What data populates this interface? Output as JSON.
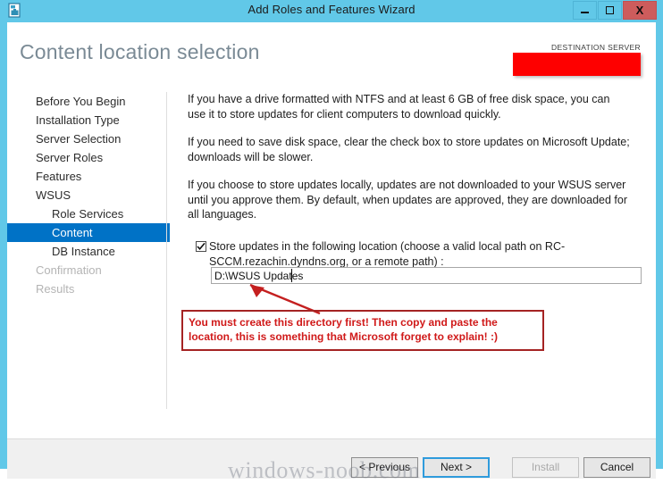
{
  "window": {
    "title": "Add Roles and Features Wizard",
    "app_icon": "server-manager-icon",
    "controls": {
      "minimize": "minimize-icon",
      "maximize": "maximize-icon",
      "close": "X"
    },
    "titlebar_color": "#61c8e8"
  },
  "header": {
    "page_title": "Content location selection",
    "destination_server_label": "DESTINATION SERVER",
    "destination_server_value": "",
    "redaction_color": "#fe0000"
  },
  "nav": {
    "items": [
      {
        "label": "Before You Begin",
        "state": "normal",
        "level": 0
      },
      {
        "label": "Installation Type",
        "state": "normal",
        "level": 0
      },
      {
        "label": "Server Selection",
        "state": "normal",
        "level": 0
      },
      {
        "label": "Server Roles",
        "state": "normal",
        "level": 0
      },
      {
        "label": "Features",
        "state": "normal",
        "level": 0
      },
      {
        "label": "WSUS",
        "state": "normal",
        "level": 0
      },
      {
        "label": "Role Services",
        "state": "normal",
        "level": 1
      },
      {
        "label": "Content",
        "state": "selected",
        "level": 1
      },
      {
        "label": "DB Instance",
        "state": "normal",
        "level": 1
      },
      {
        "label": "Confirmation",
        "state": "disabled",
        "level": 0
      },
      {
        "label": "Results",
        "state": "disabled",
        "level": 0
      }
    ],
    "selected_color": "#0072c6"
  },
  "content": {
    "paragraph1": "If you have a drive formatted with NTFS and at least 6 GB of free disk space, you can use it to store updates for client computers to download quickly.",
    "paragraph2": "If you need to save disk space, clear the check box to store updates on Microsoft Update; downloads will be slower.",
    "paragraph3": "If you choose to store updates locally, updates are not downloaded to your WSUS server until you approve them. By default, when updates are approved, they are downloaded for all languages.",
    "checkbox_label": "Store updates in the following location (choose a valid local path on RC-SCCM.rezachin.dyndns.org, or a remote path) :",
    "checkbox_checked": true,
    "path_value": "D:\\WSUS Updates",
    "path_placeholder": ""
  },
  "annotation": {
    "text": "You must create this directory first! Then copy and paste the location, this is something that Microsoft forget to explain! :)",
    "border_color": "#a52323",
    "text_color": "#d01a1a"
  },
  "footer": {
    "previous": "< Previous",
    "next": "Next >",
    "install": "Install",
    "cancel": "Cancel"
  },
  "watermark": {
    "text": "windows-noob.com"
  }
}
